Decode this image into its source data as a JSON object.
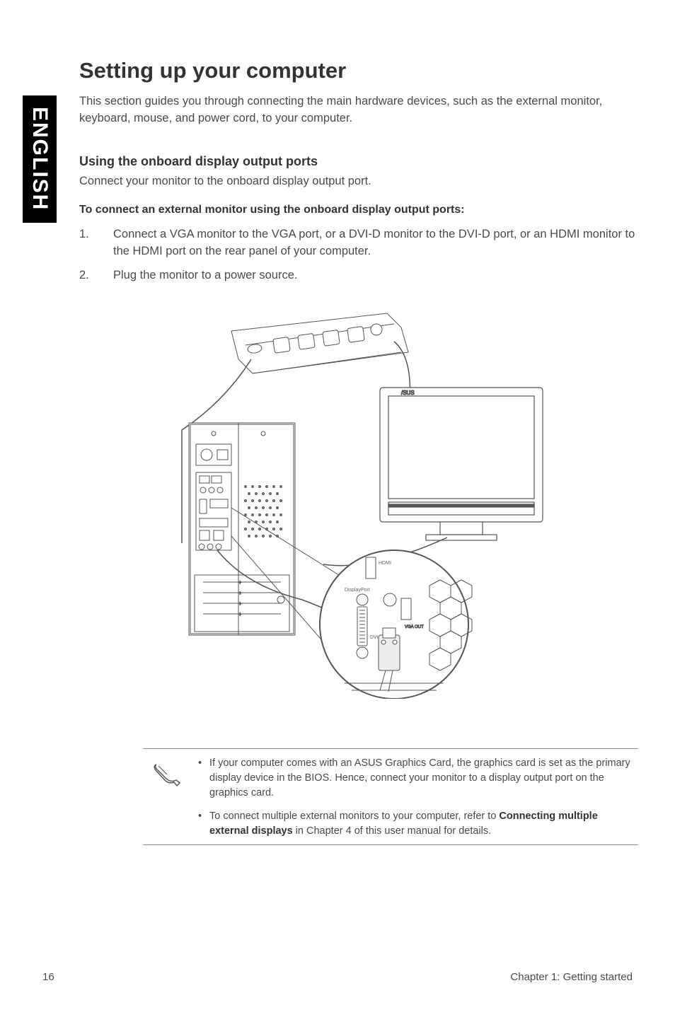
{
  "sideTab": "ENGLISH",
  "heading": "Setting up your computer",
  "intro": "This section guides you through connecting the main hardware devices, such as the external monitor, keyboard, mouse, and power cord, to your computer.",
  "section1Title": "Using the onboard display output ports",
  "section1Sub": "Connect your monitor to the onboard display output port.",
  "procTitle": "To connect an external monitor using the onboard display output ports:",
  "steps": [
    {
      "num": "1.",
      "text": "Connect a VGA monitor to the VGA port, or a DVI-D monitor to the DVI-D port, or an HDMI monitor to the HDMI port on the rear panel of your computer."
    },
    {
      "num": "2.",
      "text": "Plug the monitor to a power source."
    }
  ],
  "figureLabels": {
    "hdmi": "HDMI",
    "dp": "DisplayPort",
    "dvi": "DVI",
    "vga": "VGA OUT"
  },
  "notes": [
    {
      "pre": "If your computer comes with an ASUS Graphics Card, the graphics card is set as the primary display device in the BIOS. Hence, connect your monitor to a display output port on the graphics card.",
      "bold": "",
      "post": ""
    },
    {
      "pre": "To connect multiple external monitors to your computer, refer to ",
      "bold": "Connecting multiple external displays",
      "post": " in Chapter 4 of this user manual for details."
    }
  ],
  "footer": {
    "pageNum": "16",
    "chapter": "Chapter 1: Getting started"
  }
}
